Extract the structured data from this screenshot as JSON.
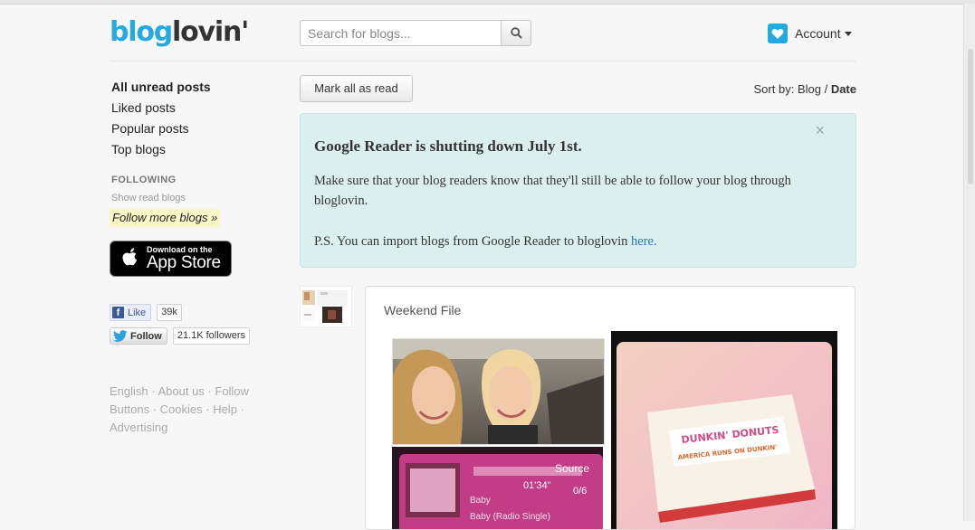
{
  "header": {
    "logo_part1": "blog",
    "logo_part2": "lovin'",
    "search": {
      "placeholder": "Search for blogs..."
    },
    "account_label": "Account"
  },
  "sidebar": {
    "nav": [
      {
        "label": "All unread posts",
        "active": true
      },
      {
        "label": "Liked posts"
      },
      {
        "label": "Popular posts"
      },
      {
        "label": "Top blogs"
      }
    ],
    "following_heading": "FOLLOWING",
    "show_read_label": "Show read blogs",
    "follow_more_label": "Follow more blogs »",
    "app_store": {
      "line1": "Download on the",
      "line2": "App Store"
    },
    "facebook": {
      "label": "Like",
      "count": "39k"
    },
    "twitter": {
      "label": "Follow",
      "count": "21.1K followers"
    },
    "footer": {
      "english": "English",
      "about": "About us",
      "follow_buttons": "Follow Buttons",
      "cookies": "Cookies",
      "help": "Help",
      "advertising": "Advertising"
    }
  },
  "toolbar": {
    "mark_all_read": "Mark all as read",
    "sort_prefix": "Sort by:",
    "sort_blog": "Blog",
    "sort_date": "Date"
  },
  "notice": {
    "close": "×",
    "title": "Google Reader is shutting down July 1st.",
    "body": "Make sure that your blog readers know that they'll still be able to follow your blog through bloglovin.",
    "ps": "P.S. You can import blogs from Google Reader to bloglovin",
    "ps_link": "here."
  },
  "post": {
    "title": "Weekend File",
    "image_text": {
      "source_label": "Source",
      "time": "01'34\"",
      "track_count": "0/6",
      "song1": "Baby",
      "song2": "Baby (Radio Single)",
      "brand": "DUNKIN' DONUTS",
      "tagline": "AMERICA RUNS ON DUNKIN'"
    }
  },
  "colors": {
    "brand_blue": "#25a9e0",
    "notice_bg": "#dcefef",
    "link_blue": "#2177b8",
    "highlight_yellow": "#fbf8c7"
  }
}
